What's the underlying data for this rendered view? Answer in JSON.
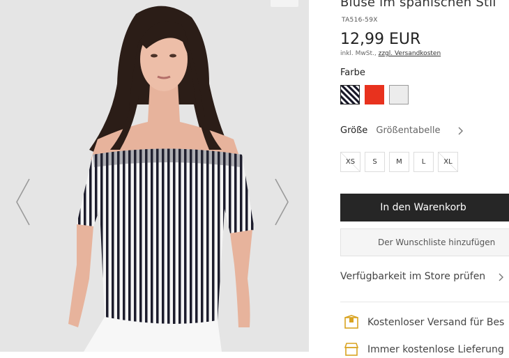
{
  "product": {
    "title": "Bluse im spanischen Stil",
    "sku": "TA516-59X",
    "price": "12,99 EUR",
    "tax_note": "inkl. MwSt., ",
    "shipping_link": "zzgl. Versandkosten"
  },
  "colors": {
    "label": "Farbe",
    "swatches": [
      "striped",
      "red",
      "light-grey"
    ]
  },
  "sizes": {
    "label": "Größe",
    "guide": "Größentabelle",
    "options": [
      "XS",
      "S",
      "M",
      "L",
      "XL"
    ],
    "unavailable": [
      "XS",
      "XL"
    ]
  },
  "actions": {
    "add_to_cart": "In den Warenkorb",
    "add_to_wishlist": "Der Wunschliste hinzufügen",
    "check_store": "Verfügbarkeit im Store prüfen"
  },
  "benefits": [
    {
      "icon": "parcel-icon",
      "text": "Kostenloser Versand für Bes"
    },
    {
      "icon": "store-icon",
      "text": "Immer kostenlose Lieferung"
    }
  ],
  "palette": {
    "button_dark": "#262626",
    "accent_red": "#e8321e",
    "benefit_icon": "#d9a321"
  }
}
